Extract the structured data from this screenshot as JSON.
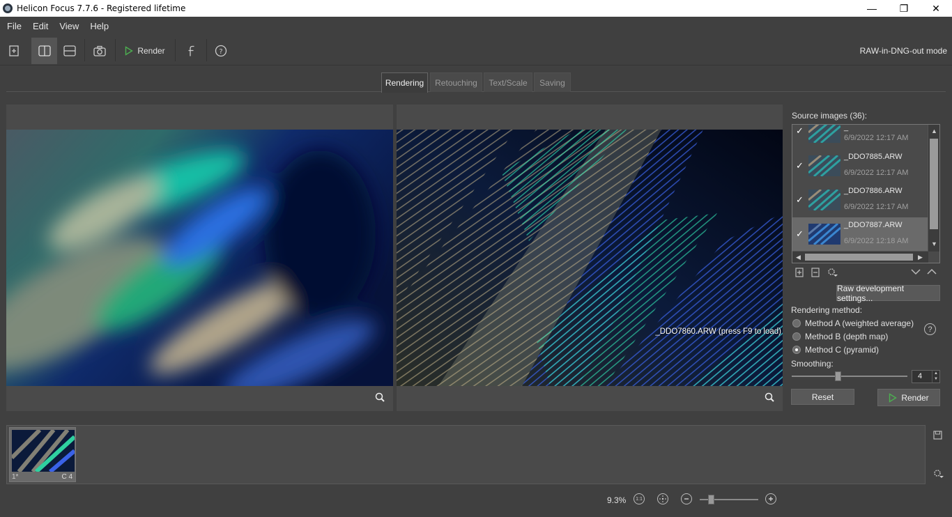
{
  "window": {
    "title": "Helicon Focus 7.7.6 - Registered  lifetime",
    "controls": [
      "minimize",
      "maximize",
      "close"
    ]
  },
  "menu": [
    "File",
    "Edit",
    "View",
    "Help"
  ],
  "toolbar": {
    "render_label": "Render",
    "mode_label": "RAW-in-DNG-out mode"
  },
  "tabs": [
    {
      "label": "Rendering",
      "active": true
    },
    {
      "label": "Retouching",
      "active": false
    },
    {
      "label": "Text/Scale",
      "active": false
    },
    {
      "label": "Saving",
      "active": false
    }
  ],
  "preview": {
    "right_caption": "_DDO7860.ARW (press F9 to load)"
  },
  "source": {
    "header": "Source images (36):",
    "items": [
      {
        "name": "_",
        "date": "6/9/2022 12:17 AM",
        "checked": true,
        "selected": false
      },
      {
        "name": "_DDO7885.ARW",
        "date": "6/9/2022 12:17 AM",
        "checked": true,
        "selected": false
      },
      {
        "name": "_DDO7886.ARW",
        "date": "6/9/2022 12:17 AM",
        "checked": true,
        "selected": false
      },
      {
        "name": "_DDO7887.ARW",
        "date": "6/9/2022 12:18 AM",
        "checked": true,
        "selected": true
      }
    ]
  },
  "raw_button": "Raw development settings...",
  "rendering": {
    "label": "Rendering method:",
    "methods": [
      {
        "label": "Method A (weighted average)",
        "selected": false
      },
      {
        "label": "Method B (depth map)",
        "selected": false
      },
      {
        "label": "Method C (pyramid)",
        "selected": true
      }
    ],
    "help": "?",
    "smoothing_label": "Smoothing:",
    "smoothing_value": "4",
    "smoothing_level": 0.4
  },
  "buttons": {
    "reset": "Reset",
    "render": "Render"
  },
  "strip": {
    "items": [
      {
        "index": "1*",
        "method": "C 4"
      }
    ]
  },
  "status": {
    "zoom": "9.3%",
    "one_to_one": "1:1"
  },
  "colors": {
    "background": "#404040",
    "panel": "#4a4a4a",
    "render_accent": "#4caf50"
  }
}
